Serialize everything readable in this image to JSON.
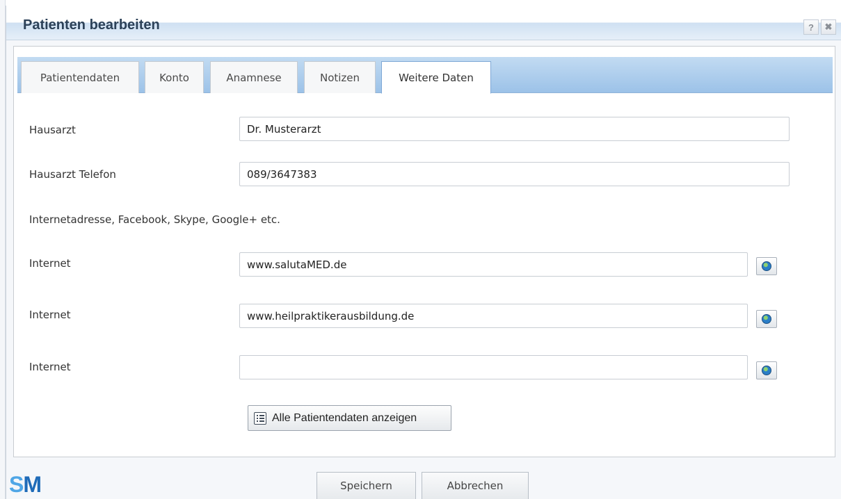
{
  "dialog": {
    "title": "Patienten bearbeiten",
    "help_label": "?",
    "close_label": "✖"
  },
  "tabs": [
    {
      "label": "Patientendaten",
      "active": false
    },
    {
      "label": "Konto",
      "active": false
    },
    {
      "label": "Anamnese",
      "active": false
    },
    {
      "label": "Notizen",
      "active": false
    },
    {
      "label": "Weitere Daten",
      "active": true
    }
  ],
  "form": {
    "hausarzt": {
      "label": "Hausarzt",
      "value": "Dr. Musterarzt"
    },
    "hausarzt_telefon": {
      "label": "Hausarzt Telefon",
      "value": "089/3647383"
    },
    "internet_hint": "Internetadresse, Facebook, Skype, Google+ etc.",
    "internet": [
      {
        "label": "Internet",
        "value": "www.salutaMED.de"
      },
      {
        "label": "Internet",
        "value": "www.heilpraktikerausbildung.de"
      },
      {
        "label": "Internet",
        "value": ""
      }
    ],
    "show_all_label": "Alle Patientendaten anzeigen"
  },
  "footer": {
    "logo_s": "S",
    "logo_m": "M",
    "save_label": "Speichern",
    "cancel_label": "Abbrechen"
  },
  "icons": {
    "help": "help-icon",
    "close": "close-icon",
    "globe": "globe-icon",
    "list": "list-icon"
  }
}
